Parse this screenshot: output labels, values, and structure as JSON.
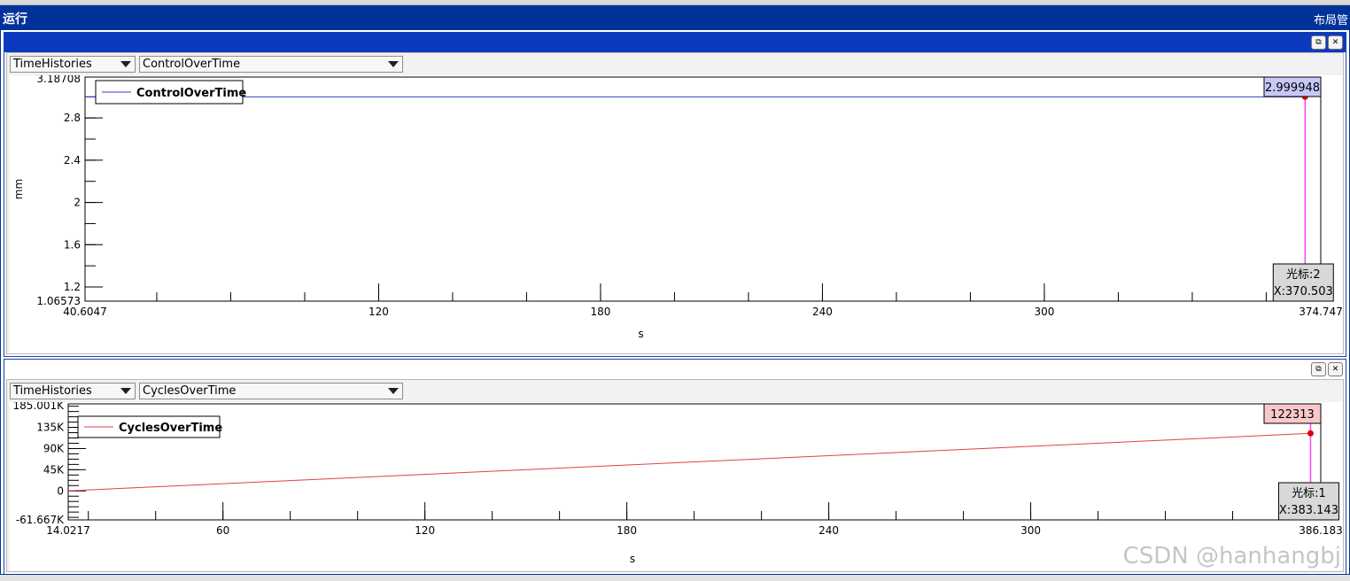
{
  "window": {
    "title": "运行",
    "right_label": "布局管"
  },
  "panels": [
    {
      "combo_category": "TimeHistories",
      "combo_channel": "ControlOverTime",
      "chart_data": {
        "type": "line",
        "title": "",
        "xlabel": "s",
        "ylabel": "mm",
        "xlim": [
          40.6047,
          374.747
        ],
        "ylim": [
          1.06573,
          3.18708
        ],
        "x_ticks": [
          "40.6047",
          "120",
          "180",
          "240",
          "300",
          "374.747"
        ],
        "y_ticks": [
          "3.18708",
          "2.8",
          "2.4",
          "2",
          "1.6",
          "1.2",
          "1.06573"
        ],
        "legend": "top-left",
        "grid": false,
        "series": [
          {
            "name": "ControlOverTime",
            "color": "#3040c0",
            "x": [
              40.6047,
              370.503
            ],
            "y": [
              2.999948,
              2.999948
            ]
          }
        ],
        "cursor": {
          "x": 370.503,
          "y": 2.999948,
          "value_label": "2.999948",
          "info_line1": "光标:2",
          "info_line2": "X:370.503",
          "line_color": "#ff44ff",
          "value_box_color": "#c8c8f8"
        }
      }
    },
    {
      "combo_category": "TimeHistories",
      "combo_channel": "CyclesOverTime",
      "chart_data": {
        "type": "line",
        "title": "",
        "xlabel": "s",
        "ylabel": "",
        "xlim": [
          14.0217,
          386.183
        ],
        "ylim": [
          -61667,
          185001
        ],
        "x_ticks": [
          "14.0217",
          "60",
          "120",
          "180",
          "240",
          "300",
          "386.183"
        ],
        "y_ticks": [
          "185.001K",
          "135K",
          "90K",
          "45K",
          "0",
          "-61.667K"
        ],
        "legend": "top-left",
        "grid": false,
        "series": [
          {
            "name": "CyclesOverTime",
            "color": "#e0404a",
            "x": [
              14.0217,
              383.143
            ],
            "y": [
              0,
              122313
            ]
          }
        ],
        "cursor": {
          "x": 383.143,
          "y": 122313,
          "value_label": "122313",
          "info_line1": "光标:1",
          "info_line2": "X:383.143",
          "line_color": "#ff44ff",
          "value_box_color": "#f8c8cc"
        }
      }
    }
  ],
  "watermark": "CSDN @hanhangbj"
}
